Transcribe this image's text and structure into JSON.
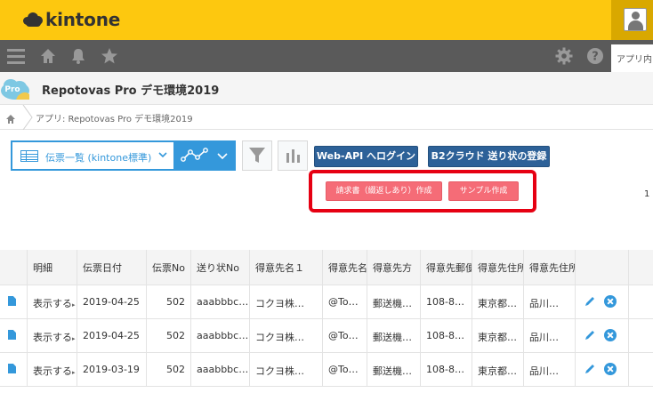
{
  "header": {
    "logo_text": "kintone"
  },
  "nav": {
    "app_tab_label": "アプリ内"
  },
  "app": {
    "title": "Repotovas Pro デモ環境2019",
    "icon_text": "Pro"
  },
  "breadcrumb": {
    "text": "アプリ: Repotovas Pro デモ環境2019"
  },
  "toolbar": {
    "view_label": "伝票一覧 (kintone標準)",
    "webapi_login": "Web-API へログイン",
    "b2_register": "B2クラウド 送り状の登録",
    "invoice_create": "請求書（綴返しあり）作成",
    "sample_create": "サンプル作成",
    "pager_number": "1"
  },
  "colors": {
    "accent_yellow": "#fdc80f",
    "nav_gray": "#5a5a5a",
    "blue": "#3498db",
    "dark_blue": "#2d6198",
    "red_button": "#f56c77",
    "highlight": "#e60012"
  },
  "table": {
    "columns": [
      "明細",
      "伝票日付",
      "伝票No",
      "送り状No",
      "得意先名１",
      "得意先名",
      "得意先方",
      "得意先郵便",
      "得意先住所",
      "得意先住所"
    ],
    "rows": [
      {
        "detail": "表示する",
        "date": "2019-04-25",
        "no": "502",
        "slip": "aaabbbc…",
        "name1": "コクヨ株…",
        "name2": "@To…",
        "method": "郵送機…",
        "postal": "108-8…",
        "addr1": "東京都…",
        "addr2": "品川…"
      },
      {
        "detail": "表示する",
        "date": "2019-04-25",
        "no": "502",
        "slip": "aaabbbc…",
        "name1": "コクヨ株…",
        "name2": "@To…",
        "method": "郵送機…",
        "postal": "108-8…",
        "addr1": "東京都…",
        "addr2": "品川…"
      },
      {
        "detail": "表示する",
        "date": "2019-03-19",
        "no": "502",
        "slip": "aaabbbc…",
        "name1": "コクヨ株…",
        "name2": "@To…",
        "method": "郵送機…",
        "postal": "108-8…",
        "addr1": "東京都…",
        "addr2": "品川…"
      }
    ]
  }
}
